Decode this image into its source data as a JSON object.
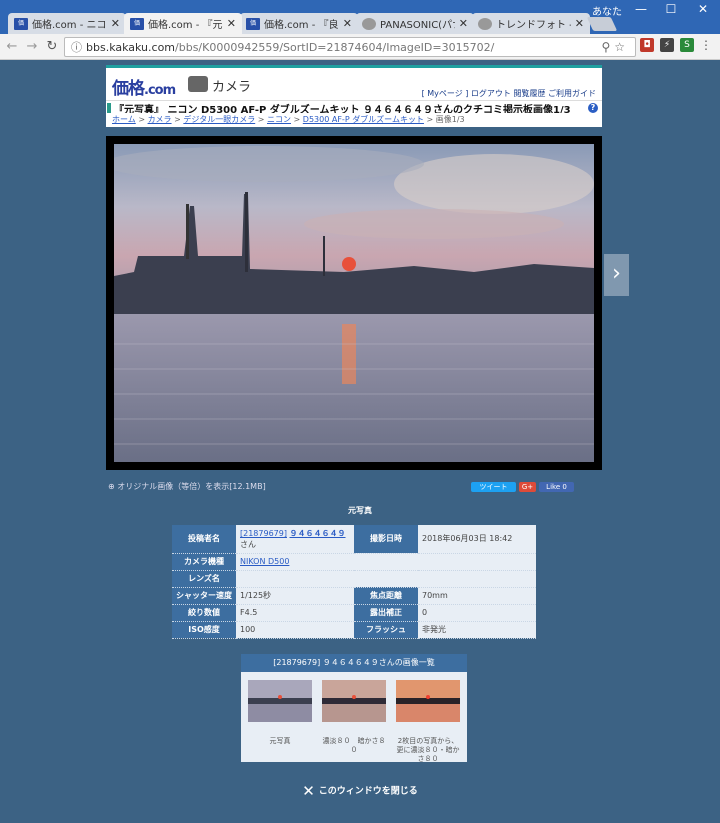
{
  "browser": {
    "tabs": [
      {
        "title": "価格.com - ニコン D5",
        "favicon": "kakaku",
        "active": false
      },
      {
        "title": "価格.com - 『元写真』",
        "favicon": "kakaku",
        "active": true
      },
      {
        "title": "価格.com - 『良いね",
        "favicon": "kakaku",
        "active": false
      },
      {
        "title": "PANASONIC(パナソニ",
        "favicon": "generic",
        "active": false
      },
      {
        "title": "トレンドフォト - 写真言",
        "favicon": "generic",
        "active": false
      }
    ],
    "user_label": "あなた",
    "url_host": "bbs.kakaku.com",
    "url_path": "/bbs/K0000942559/SortID=21874604/ImageID=3015702/"
  },
  "header": {
    "logo": "価格",
    "logo_suffix": ".com",
    "section": "カメラ",
    "links": "[ Myページ ] ログアウト 閲覧履歴 ご利用ガイド",
    "title": "『元写真』 ニコン D5300 AF-P ダブルズームキット ９４６４６４９さんのクチコミ掲示板画像1/3",
    "help": "?"
  },
  "breadcrumb": {
    "items": [
      "ホーム",
      "カメラ",
      "デジタル一眼カメラ",
      "ニコン",
      "D5300 AF-P ダブルズームキット"
    ],
    "current": "画像1/3",
    "separator": ">"
  },
  "photo_nav": {
    "next": "›"
  },
  "original_link": "オリジナル画像（等倍）を表示[12.1MB]",
  "share": {
    "tweet": "ツイート",
    "gplus": "G+",
    "like": "Like 0"
  },
  "caption": "元写真",
  "info": {
    "poster_label": "投稿者名",
    "poster_id": "[21879679]",
    "poster_name": "９４６４６４９",
    "poster_suffix": "さん",
    "date_label": "撮影日時",
    "date": "2018年06月03日 18:42",
    "camera_label": "カメラ機種",
    "camera": "NIKON D500",
    "lens_label": "レンズ名",
    "lens": "",
    "shutter_label": "シャッター速度",
    "shutter": "1/125秒",
    "focal_label": "焦点距離",
    "focal": "70mm",
    "aperture_label": "絞り数値",
    "aperture": "F4.5",
    "exposure_label": "露出補正",
    "exposure": "0",
    "iso_label": "ISO感度",
    "iso": "100",
    "flash_label": "フラッシュ",
    "flash": "非発光"
  },
  "thumbs": {
    "heading": "[21879679] ９４６４６４９さんの画像一覧",
    "items": [
      {
        "caption": "元写真"
      },
      {
        "caption": "濃淡８０　暗かさ８０"
      },
      {
        "caption": "2枚目の写真から、更に濃淡８０・暗かさ８０"
      }
    ]
  },
  "close_label": "このウィンドウを閉じる"
}
